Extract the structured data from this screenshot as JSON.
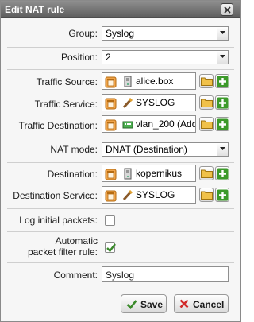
{
  "dialog": {
    "title": "Edit NAT rule"
  },
  "fields": {
    "group": {
      "label": "Group:",
      "value": "Syslog"
    },
    "position": {
      "label": "Position:",
      "value": "2"
    },
    "traffic_source": {
      "label": "Traffic Source:",
      "value": "alice.box",
      "icon": "host-icon"
    },
    "traffic_service": {
      "label": "Traffic Service:",
      "value": "SYSLOG",
      "icon": "service-icon"
    },
    "traffic_destination": {
      "label": "Traffic Destination:",
      "value": "vlan_200 (Add",
      "icon": "network-icon"
    },
    "nat_mode": {
      "label": "NAT mode:",
      "value": "DNAT (Destination)"
    },
    "destination": {
      "label": "Destination:",
      "value": "kopernikus",
      "icon": "host-icon"
    },
    "destination_service": {
      "label": "Destination Service:",
      "value": "SYSLOG",
      "icon": "service-icon"
    },
    "log_initial": {
      "label": "Log initial packets:",
      "checked": false
    },
    "auto_filter": {
      "label_line1": "Automatic",
      "label_line2": "packet filter rule:",
      "checked": true
    },
    "comment": {
      "label": "Comment:",
      "value": "Syslog"
    }
  },
  "buttons": {
    "save": "Save",
    "cancel": "Cancel"
  },
  "colors": {
    "plus_green": "#3c9a2a",
    "folder_orange": "#e9b43a",
    "cancel_red": "#d12a2a",
    "check_green": "#3a8a2a"
  }
}
